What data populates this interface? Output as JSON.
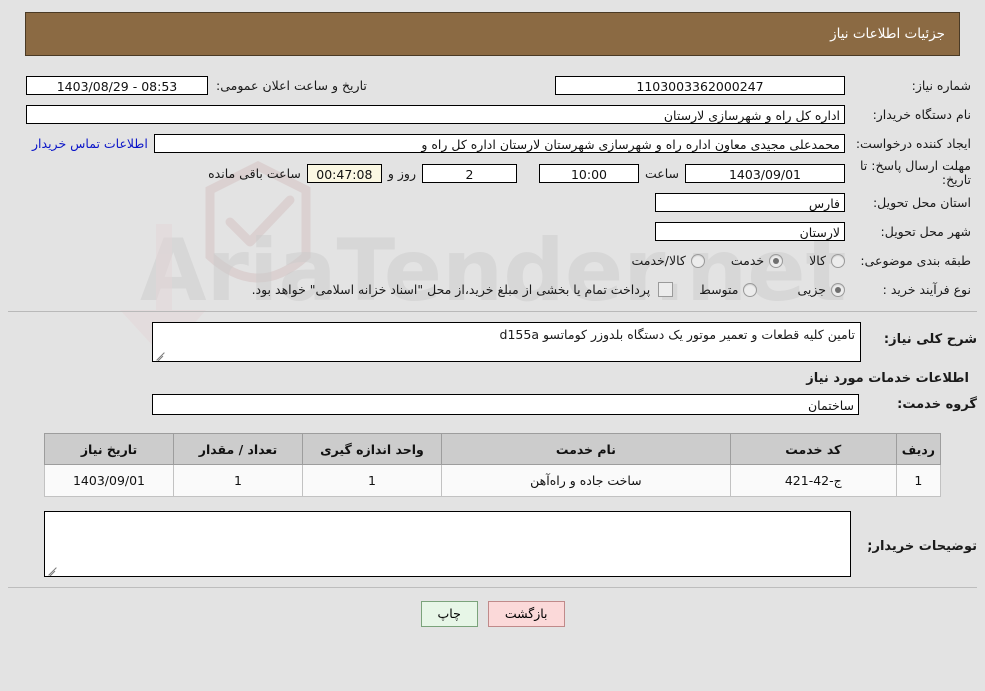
{
  "header": {
    "title": "جزئیات اطلاعات نیاز"
  },
  "form": {
    "need_number_label": "شماره نیاز:",
    "need_number": "1103003362000247",
    "announce_label": "تاریخ و ساعت اعلان عمومی:",
    "announce_value": "08:53 - 1403/08/29",
    "buyer_org_label": "نام دستگاه خریدار:",
    "buyer_org": "اداره کل راه و شهرسازی لارستان",
    "creator_label": "ایجاد کننده درخواست:",
    "creator": "محمدعلی مجیدی معاون اداره راه و شهرسازی شهرستان لارستان اداره کل راه و",
    "contact_link": "اطلاعات تماس خریدار",
    "deadline_label": "مهلت ارسال پاسخ: تا تاریخ:",
    "deadline_date": "1403/09/01",
    "hour_label": "ساعت",
    "deadline_time": "10:00",
    "days_remaining": "2",
    "days_word": "روز و",
    "countdown": "00:47:08",
    "remaining_suffix": "ساعت باقی مانده",
    "province_label": "استان محل تحویل:",
    "province": "فارس",
    "city_label": "شهر محل تحویل:",
    "city": "لارستان",
    "category_label": "طبقه بندی موضوعی:",
    "category_options": [
      {
        "label": "کالا",
        "selected": false
      },
      {
        "label": "خدمت",
        "selected": true
      },
      {
        "label": "کالا/خدمت",
        "selected": false
      }
    ],
    "process_label": "نوع فرآیند خرید :",
    "process_options": [
      {
        "label": "جزیی",
        "selected": true
      },
      {
        "label": "متوسط",
        "selected": false
      }
    ],
    "treasury_checkbox_checked": false,
    "treasury_note": "پرداخت تمام یا بخشی از مبلغ خرید،از محل \"اسناد خزانه اسلامی\" خواهد بود."
  },
  "description": {
    "label": "شرح کلی نیاز:",
    "value": "تامین کلیه قطعات و تعمیر موتور یک دستگاه بلدوزر کوماتسو d155a"
  },
  "services_section": {
    "heading": "اطلاعات خدمات مورد نیاز",
    "group_label": "گروه خدمت:",
    "group_value": "ساختمان"
  },
  "table": {
    "columns": [
      "ردیف",
      "کد خدمت",
      "نام خدمت",
      "واحد اندازه گیری",
      "تعداد / مقدار",
      "تاریخ نیاز"
    ],
    "rows": [
      {
        "row": "1",
        "code": "ج-42-421",
        "name": "ساخت جاده و راه‌آهن",
        "unit": "1",
        "quantity": "1",
        "date": "1403/09/01"
      }
    ]
  },
  "buyer_notes": {
    "label": "توضیحات خریدار;",
    "value": ""
  },
  "footer": {
    "print_label": "چاپ",
    "back_label": "بازگشت"
  },
  "watermark": {
    "text": "AriaTender.net"
  },
  "colors": {
    "header_bg": "#8b6a43",
    "link": "#0a14c8",
    "print_btn": "#e7f6e7",
    "back_btn": "#fbd9d9",
    "countdown_bg": "#fbf8e3"
  }
}
